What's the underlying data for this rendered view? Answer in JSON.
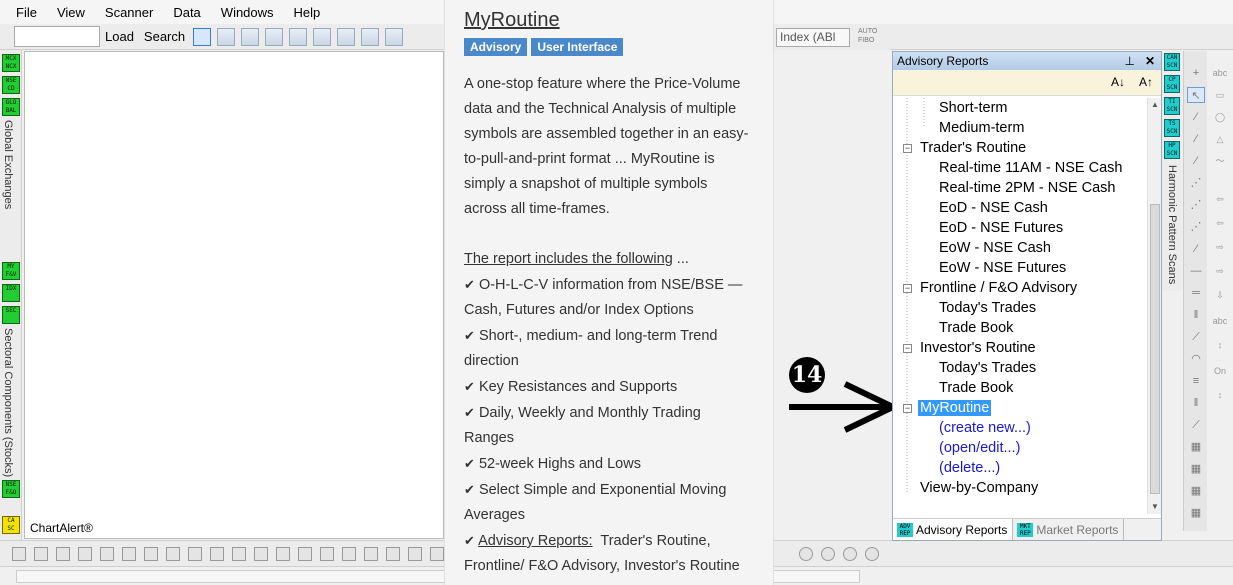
{
  "menu": [
    "File",
    "View",
    "Scanner",
    "Data",
    "Windows",
    "Help"
  ],
  "toolbar": {
    "load_label": "Load",
    "search_label": "Search",
    "index_select": "Index (ABl"
  },
  "left_strip": {
    "badges": [
      "MCX NCX",
      "NSE CD",
      "GLO BAL",
      "MY F&V",
      "IDX",
      "SEC",
      "NSE F&O",
      "CA SC"
    ],
    "labels": [
      "Global Exchanges",
      "Sectoral Components (Stocks)"
    ]
  },
  "chart_alert_label": "ChartAlert®",
  "popup": {
    "title": "MyRoutine",
    "tags": [
      "Advisory",
      "User Interface"
    ],
    "intro": "A one-stop feature where the Price-Volume data and the Technical Analysis of multiple symbols are assembled together in an easy-to-pull-and-print format ... MyRoutine is simply a snapshot of multiple symbols across all time-frames.",
    "includes_heading": "The report includes the following",
    "includes_suffix": " ...",
    "features": [
      "O-H-L-C-V information from NSE/BSE — Cash, Futures and/or Index Options",
      "Short-, medium- and long-term Trend direction",
      "Key Resistances and Supports",
      "Daily, Weekly and Monthly Trading Ranges",
      "52-week Highs and Lows",
      "Select Simple and Exponential Moving Averages"
    ],
    "advisory_label": "Advisory Reports:",
    "advisory_text": "Trader's Routine, Frontline/ F&O Advisory, Investor's Routine"
  },
  "annotation": {
    "step_number": "14"
  },
  "panel": {
    "title": "Advisory Reports",
    "sort_asc": "A↓",
    "sort_desc": "A↑",
    "tree": [
      {
        "label": "Short-term",
        "level": 2,
        "type": "leaf"
      },
      {
        "label": "Medium-term",
        "level": 2,
        "type": "leaf"
      },
      {
        "label": "Trader's Routine",
        "level": 1,
        "type": "folder"
      },
      {
        "label": "Real-time 11AM - NSE Cash",
        "level": 2,
        "type": "leaf"
      },
      {
        "label": "Real-time 2PM - NSE Cash",
        "level": 2,
        "type": "leaf"
      },
      {
        "label": "EoD - NSE Cash",
        "level": 2,
        "type": "leaf"
      },
      {
        "label": "EoD - NSE Futures",
        "level": 2,
        "type": "leaf"
      },
      {
        "label": "EoW - NSE Cash",
        "level": 2,
        "type": "leaf"
      },
      {
        "label": "EoW - NSE Futures",
        "level": 2,
        "type": "leaf"
      },
      {
        "label": "Frontline / F&O Advisory",
        "level": 1,
        "type": "folder"
      },
      {
        "label": "Today's Trades",
        "level": 2,
        "type": "leaf"
      },
      {
        "label": "Trade Book",
        "level": 2,
        "type": "leaf"
      },
      {
        "label": "Investor's Routine",
        "level": 1,
        "type": "folder"
      },
      {
        "label": "Today's Trades",
        "level": 2,
        "type": "leaf"
      },
      {
        "label": "Trade Book",
        "level": 2,
        "type": "leaf"
      },
      {
        "label": "MyRoutine",
        "level": 1,
        "type": "folder",
        "selected": true
      },
      {
        "label": "(create new...)",
        "level": 2,
        "type": "link"
      },
      {
        "label": "(open/edit...)",
        "level": 2,
        "type": "link"
      },
      {
        "label": "(delete...)",
        "level": 2,
        "type": "link"
      },
      {
        "label": "View-by-Company",
        "level": 1,
        "type": "plain"
      }
    ],
    "tabs": [
      {
        "icon": "ADV REP",
        "label": "Advisory Reports",
        "active": true
      },
      {
        "icon": "MKT REP",
        "label": "Market Reports",
        "active": false
      }
    ]
  },
  "right_strip": {
    "badges": [
      "CAN SCN",
      "CP SCN",
      "TI SCN",
      "TS SCN",
      "HP SCN"
    ],
    "label": "Harmonic Pattern Scans"
  },
  "colors": {
    "accent": "#3399ff",
    "tag_bg": "#4a88c9",
    "badge_green": "#22cc33",
    "badge_cyan": "#22cccc",
    "link": "#1a1acc"
  }
}
